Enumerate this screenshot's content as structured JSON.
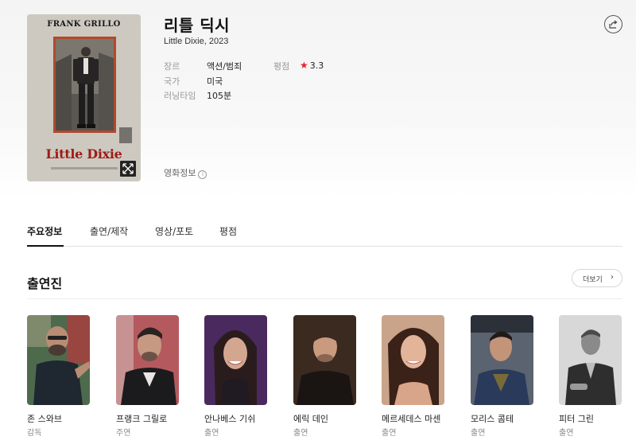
{
  "movie": {
    "title": "리틀 딕시",
    "subtitle": "Little Dixie, 2023",
    "poster": {
      "actor_text": "FRANK GRILLO",
      "title_text": "Little Dixie"
    },
    "genre_label": "장르",
    "genre_value": "액션/범죄",
    "country_label": "국가",
    "country_value": "미국",
    "runtime_label": "러닝타임",
    "runtime_value": "105분",
    "rating_label": "평점",
    "rating_star": "★",
    "rating_value": "3.3",
    "info_link": "영화정보",
    "info_icon": "i"
  },
  "tabs": [
    {
      "label": "주요정보",
      "active": true
    },
    {
      "label": "출연/제작",
      "active": false
    },
    {
      "label": "영상/포토",
      "active": false
    },
    {
      "label": "평점",
      "active": false
    }
  ],
  "cast_section": {
    "title": "출연진",
    "more_label": "더보기",
    "more_icon": "›",
    "members": [
      {
        "name": "존 스와브",
        "role": "감독"
      },
      {
        "name": "프랭크 그릴로",
        "role": "주연"
      },
      {
        "name": "안나베스 기쉬",
        "role": "출연"
      },
      {
        "name": "에릭 데인",
        "role": "출연"
      },
      {
        "name": "메르세데스 마센",
        "role": "출연"
      },
      {
        "name": "모리스 콤테",
        "role": "출연"
      },
      {
        "name": "피터 그린",
        "role": "출연"
      }
    ]
  },
  "colors": {
    "accent_star": "#e8202e",
    "poster_title": "#9c1c15"
  },
  "icons": {
    "share": "share-icon",
    "expand": "expand-icon",
    "info": "info-icon",
    "chevron": "chevron-right-icon"
  }
}
